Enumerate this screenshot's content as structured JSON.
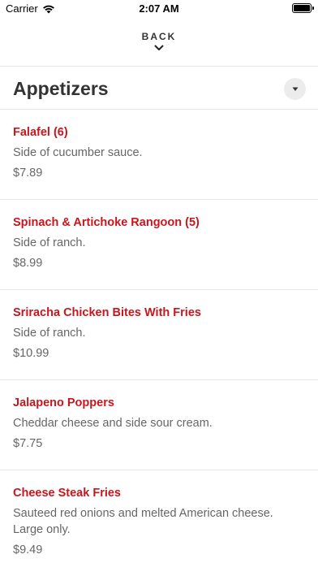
{
  "status_bar": {
    "carrier": "Carrier",
    "time": "2:07 AM"
  },
  "nav": {
    "back_label": "BACK"
  },
  "section": {
    "title": "Appetizers"
  },
  "menu": {
    "items": [
      {
        "name": "Falafel (6)",
        "description": "Side of cucumber sauce.",
        "price": "$7.89"
      },
      {
        "name": "Spinach & Artichoke Rangoon (5)",
        "description": "Side of ranch.",
        "price": "$8.99"
      },
      {
        "name": "Sriracha Chicken Bites With Fries",
        "description": "Side of ranch.",
        "price": "$10.99"
      },
      {
        "name": "Jalapeno Poppers",
        "description": "Cheddar cheese and side sour cream.",
        "price": "$7.75"
      },
      {
        "name": "Cheese Steak Fries",
        "description": "Sauteed red onions and melted American cheese. Large only.",
        "price": "$9.49"
      }
    ]
  },
  "colors": {
    "item_name": "#c8161d",
    "text_secondary": "#666666",
    "divider": "#e8e8e8"
  },
  "icons": {
    "wifi": "wifi-icon",
    "battery": "battery-icon",
    "back_chevron": "chevron-down-icon",
    "dropdown": "caret-down-icon"
  }
}
